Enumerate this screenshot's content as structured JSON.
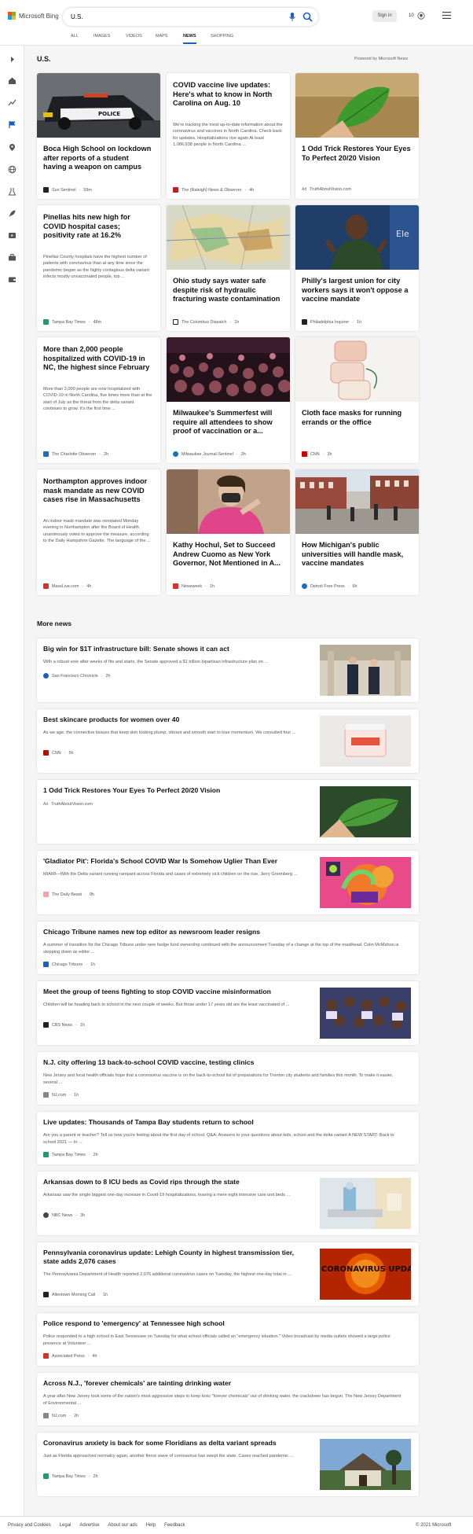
{
  "header": {
    "logo_text": "Microsoft Bing",
    "search_value": "U.S.",
    "signin_label": "Sign in",
    "rewards_count": "10",
    "tabs": [
      "ALL",
      "IMAGES",
      "VIDEOS",
      "MAPS",
      "NEWS",
      "SHOPPING"
    ],
    "active_tab": "NEWS"
  },
  "section": {
    "title": "U.S.",
    "powered": "Powered by Microsoft News"
  },
  "cards": [
    {
      "title": "Boca High School on lockdown after reports of a student having a weapon on campus",
      "desc": "",
      "source": "Sun Sentinel",
      "time": "59m",
      "ad": ""
    },
    {
      "title": "COVID vaccine live updates: Here's what to know in North Carolina on Aug. 10",
      "desc": "We're tracking the most up-to-date information about the coronavirus and vaccines in North Carolina. Check back for updates. Hospitalizations rise again At least 1,086,938 people in North Carolina ...",
      "source": "The (Raleigh) News & Observer",
      "time": "4h",
      "ad": ""
    },
    {
      "title": "1 Odd Trick Restores Your Eyes To Perfect 20/20 Vision",
      "desc": "",
      "source": "TruthAboutVision.com",
      "time": "",
      "ad": "Ad"
    },
    {
      "title": "Pinellas hits new high for COVID hospital cases; positivity rate at 16.2%",
      "desc": "Pinellas County hospitals have the highest number of patients with coronavirus than at any time since the pandemic began as the highly contagious delta variant infects mostly unvaccinated people, top ...",
      "source": "Tampa Bay Times",
      "time": "48m",
      "ad": ""
    },
    {
      "title": "Ohio study says water safe despite risk of hydraulic fracturing waste contamination",
      "desc": "",
      "source": "The Columbus Dispatch",
      "time": "1h",
      "ad": ""
    },
    {
      "title": "Philly's largest union for city workers says it won't oppose a vaccine mandate",
      "desc": "",
      "source": "Philadelphia Inquirer",
      "time": "1h",
      "ad": ""
    },
    {
      "title": "More than 2,000 people hospitalized with COVID-19 in NC, the highest since February",
      "desc": "More than 2,000 people are now hospitalized with COVID-19 in North Carolina, five times more than at the start of July as the threat from the delta variant continues to grow. It's the first time ...",
      "source": "The Charlotte Observer",
      "time": "2h",
      "ad": ""
    },
    {
      "title": "Milwaukee's Summerfest will require all attendees to show proof of vaccination or a...",
      "desc": "",
      "source": "Milwaukee Journal-Sentinel",
      "time": "3h",
      "ad": ""
    },
    {
      "title": "Cloth face masks for running errands or the office",
      "desc": "",
      "source": "CNN",
      "time": "3h",
      "ad": ""
    },
    {
      "title": "Northampton approves indoor mask mandate as new COVID cases rise in Massachusetts",
      "desc": "An indoor mask mandate was reinstated Monday evening in Northampton after the Board of Health unanimously voted to approve the measure, according to the Daily Hampshire Gazette. The language of the ...",
      "source": "MassLive.com",
      "time": "4h",
      "ad": ""
    },
    {
      "title": "Kathy Hochul, Set to Succeed Andrew Cuomo as New York Governor, Not Mentioned in A...",
      "desc": "",
      "source": "Newsweek",
      "time": "1h",
      "ad": ""
    },
    {
      "title": "How Michigan's public universities will handle mask, vaccine mandates",
      "desc": "",
      "source": "Detroit Free Press",
      "time": "6h",
      "ad": ""
    }
  ],
  "more_news": {
    "title": "More news",
    "items": [
      {
        "title": "Big win for $1T infrastructure bill: Senate shows it can act",
        "desc": "With a robust vote after weeks of fits and starts, the Senate approved a $1 trillion bipartisan infrastructure plan on ...",
        "source": "San Francisco Chronicle",
        "time": "2h",
        "ad": ""
      },
      {
        "title": "Best skincare products for women over 40",
        "desc": "As we age, the connective tissues that keep skin looking plump, vibrant and smooth start to lose momentum. We consulted four ...",
        "source": "CNN",
        "time": "5h",
        "ad": ""
      },
      {
        "title": "1 Odd Trick Restores Your Eyes To Perfect 20/20 Vision",
        "desc": "",
        "source": "TruthAboutVision.com",
        "time": "",
        "ad": "Ad"
      },
      {
        "title": "'Gladiator Pit': Florida's School COVID War Is Somehow Uglier Than Ever",
        "desc": "MIAMI—With the Delta variant running rampant across Florida and cases of extremely sick children on the rise, Jerry Greenberg ...",
        "source": "The Daily Beast",
        "time": "9h",
        "ad": ""
      },
      {
        "title": "Chicago Tribune names new top editor as newsroom leader resigns",
        "desc": "A summer of transition for the Chicago Tribune under new hedge fund ownership continued with the announcement Tuesday of a change at the top of the masthead. Colin McMahon is stepping down as editor ...",
        "source": "Chicago Tribune",
        "time": "1h",
        "ad": ""
      },
      {
        "title": "Meet the group of teens fighting to stop COVID vaccine misinformation",
        "desc": "Children will be heading back to school in the next couple of weeks. But those under 17 years old are the least vaccinated of ...",
        "source": "CBS News",
        "time": "1h",
        "ad": ""
      },
      {
        "title": "N.J. city offering 13 back-to-school COVID vaccine, testing clinics",
        "desc": "New Jersey and local health officials hope that a coronavirus vaccine is on the back-to-school list of preparations for Trenton city students and families this month. To make it easier, several ...",
        "source": "NJ.com",
        "time": "1h",
        "ad": ""
      },
      {
        "title": "Live updates: Thousands of Tampa Bay students return to school",
        "desc": "Are you a parent or teacher? Tell us how you're feeling about the first day of school. Q&A: Answers to your questions about kids, school and the delta variant A NEW START: Back to school 2021 — In ...",
        "source": "Tampa Bay Times",
        "time": "2h",
        "ad": ""
      },
      {
        "title": "Arkansas down to 8 ICU beds as Covid rips through the state",
        "desc": "Arkansas saw the single biggest one-day increase in Covid-19 hospitalizations, leaving a mere eight intensive care unit beds ...",
        "source": "NBC News",
        "time": "3h",
        "ad": ""
      },
      {
        "title": "Pennsylvania coronavirus update: Lehigh County in highest transmission tier, state adds 2,076 cases",
        "desc": "The Pennsylvania Department of Health reported 2,076 additional coronavirus cases on Tuesday, the highest one-day total in ...",
        "source": "Allentown Morning Call",
        "time": "1h",
        "ad": "",
        "image_text": "PA CORONAVIRUS UPDATE"
      },
      {
        "title": "Police respond to 'emergency' at Tennessee high school",
        "desc": "Police responded to a high school in East Tennessee on Tuesday for what school officials called an \"emergency situation.\" Video broadcast by media outlets showed a large police presence at Volunteer ...",
        "source": "Associated Press",
        "time": "4h",
        "ad": ""
      },
      {
        "title": "Across N.J., 'forever chemicals' are tainting drinking water",
        "desc": "A year after New Jersey took some of the nation's most aggressive steps to keep toxic \"forever chemicals\" out of drinking water, the crackdown has begun. The New Jersey Department of Environmental ...",
        "source": "NJ.com",
        "time": "2h",
        "ad": ""
      },
      {
        "title": "Coronavirus anxiety is back for some Floridians as delta variant spreads",
        "desc": "Just as Florida approached normalcy again, another fierce wave of coronavirus has swept the state. Cases reached pandemic ...",
        "source": "Tampa Bay Times",
        "time": "2h",
        "ad": ""
      }
    ]
  },
  "footer": {
    "links": [
      "Privacy and Cookies",
      "Legal",
      "Advertise",
      "About our ads",
      "Help",
      "Feedback"
    ],
    "copyright": "© 2021 Microsoft"
  },
  "colors": {
    "accent": "#1a5ec2",
    "bg": "#f5f5f5"
  }
}
